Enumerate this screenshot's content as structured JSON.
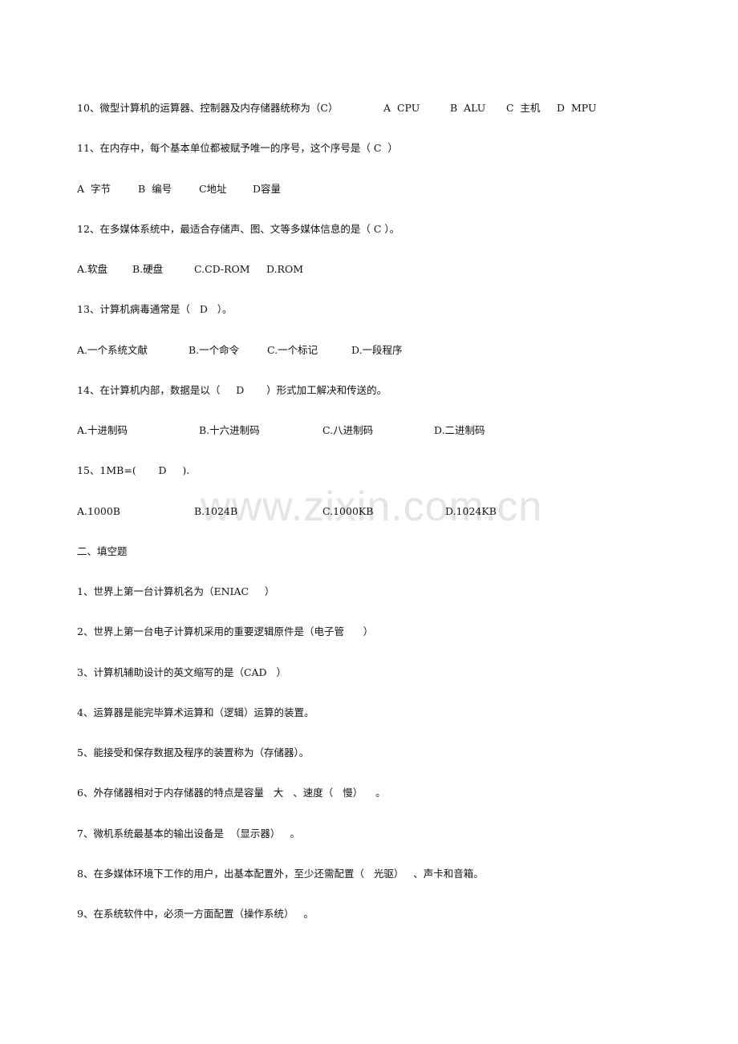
{
  "watermark": "www.zixin.com.cn",
  "questions": {
    "q10": {
      "stem": "10、微型计算机的运算器、控制器及内存储器统称为（C）",
      "options": [
        "A  CPU",
        "B  ALU",
        "C  主机",
        "D  MPU"
      ]
    },
    "q11": {
      "stem": "11、在内存中，每个基本单位都被赋予唯一的序号，这个序号是（ C  ）",
      "options": [
        "A  字节",
        "B  编号",
        "C地址",
        "D容量"
      ]
    },
    "q12": {
      "stem": "12、在多媒体系统中，最适合存储声、图、文等多媒体信息的是（ C ）。",
      "options": [
        "A.软盘",
        "B.硬盘",
        "C.CD-ROM",
        "D.ROM"
      ]
    },
    "q13": {
      "stem": "13、计算机病毒通常是（   D   ）。",
      "options": [
        "A.一个系统文献",
        "B.一个命令",
        "C.一个标记",
        "D.一段程序"
      ]
    },
    "q14": {
      "stem": "14、在计算机内部，数据是以（     D       ）形式加工解决和传送的。",
      "options": [
        "A.十进制码",
        "B.十六进制码",
        "C.八进制码",
        "D.二进制码"
      ]
    },
    "q15": {
      "stem": "15、1MB=(       D     ).",
      "options": [
        "A.1000B",
        "B.1024B",
        "C.1000KB",
        "D.1024KB"
      ]
    }
  },
  "section2": {
    "title": "二、填空题",
    "items": [
      "1、世界上第一台计算机名为（ENIAC     ）",
      "2、世界上第一台电子计算机采用的重要逻辑原件是（电子管      ）",
      "3、计算机辅助设计的英文缩写的是（CAD   ）",
      "4、运算器是能完毕算术运算和（逻辑）运算的装置。",
      "5、能接受和保存数据及程序的装置称为（存储器）。",
      "6、外存储器相对于内存储器的特点是容量   大   、速度（   慢）    。",
      "7、微机系统最基本的输出设备是  （显示器）   。",
      "8、在多媒体环境下工作的用户，出基本配置外，至少还需配置（   光驱）   、声卡和音箱。",
      "9、在系统软件中，必须一方面配置（操作系统）   。"
    ]
  }
}
